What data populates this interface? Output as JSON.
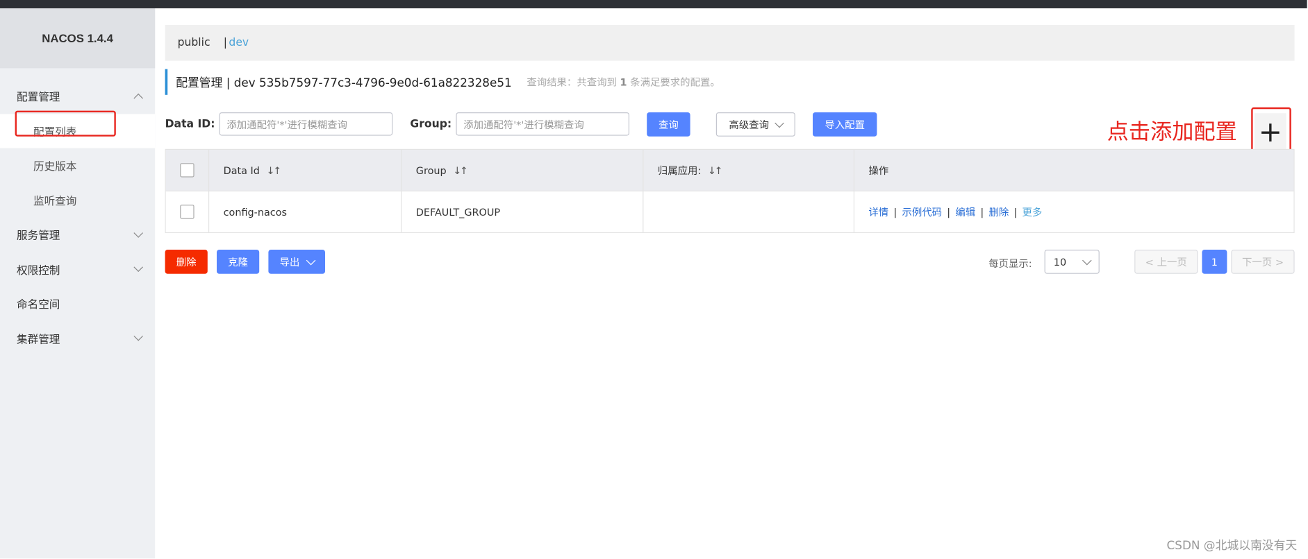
{
  "app": {
    "logo": "NACOS 1.4.4"
  },
  "sidebar": {
    "items": [
      {
        "label": "配置管理",
        "expanded": true
      },
      {
        "label": "配置列表"
      },
      {
        "label": "历史版本"
      },
      {
        "label": "监听查询"
      },
      {
        "label": "服务管理"
      },
      {
        "label": "权限控制"
      },
      {
        "label": "命名空间"
      },
      {
        "label": "集群管理"
      }
    ]
  },
  "namespace": {
    "public": "public",
    "sep": "|",
    "dev": "dev"
  },
  "header": {
    "title": "配置管理 | dev  535b7597-77c3-4796-9e0d-61a822328e51",
    "hint_prefix": "查询结果：共查询到",
    "hint_count": "1",
    "hint_suffix": "条满足要求的配置。"
  },
  "search": {
    "dataid_label": "Data ID:",
    "dataid_placeholder": "添加通配符'*'进行模糊查询",
    "group_label": "Group:",
    "group_placeholder": "添加通配符'*'进行模糊查询",
    "query_button": "查询",
    "advanced_button": "高级查询",
    "import_button": "导入配置"
  },
  "annotation": {
    "add_callout": "点击添加配置",
    "add_symbol": "+"
  },
  "table": {
    "columns": [
      "Data Id",
      "Group",
      "归属应用:",
      "操作"
    ],
    "sort_glyph": "↓↑",
    "rows": [
      {
        "data_id": "config-nacos",
        "group": "DEFAULT_GROUP",
        "app": "",
        "ops": [
          "详情",
          "示例代码",
          "编辑",
          "删除"
        ],
        "more": "更多"
      }
    ]
  },
  "bulk": {
    "delete": "删除",
    "clone": "克隆",
    "export": "导出"
  },
  "pager": {
    "page_size_label": "每页显示:",
    "page_size": "10",
    "prev": "上一页",
    "current": "1",
    "next": "下一页"
  },
  "watermark": "CSDN @北城以南没有天",
  "colors": {
    "primary": "#5584ff",
    "danger": "#f52b00",
    "annotation": "#e8261f",
    "link": "#2b6fd6"
  }
}
